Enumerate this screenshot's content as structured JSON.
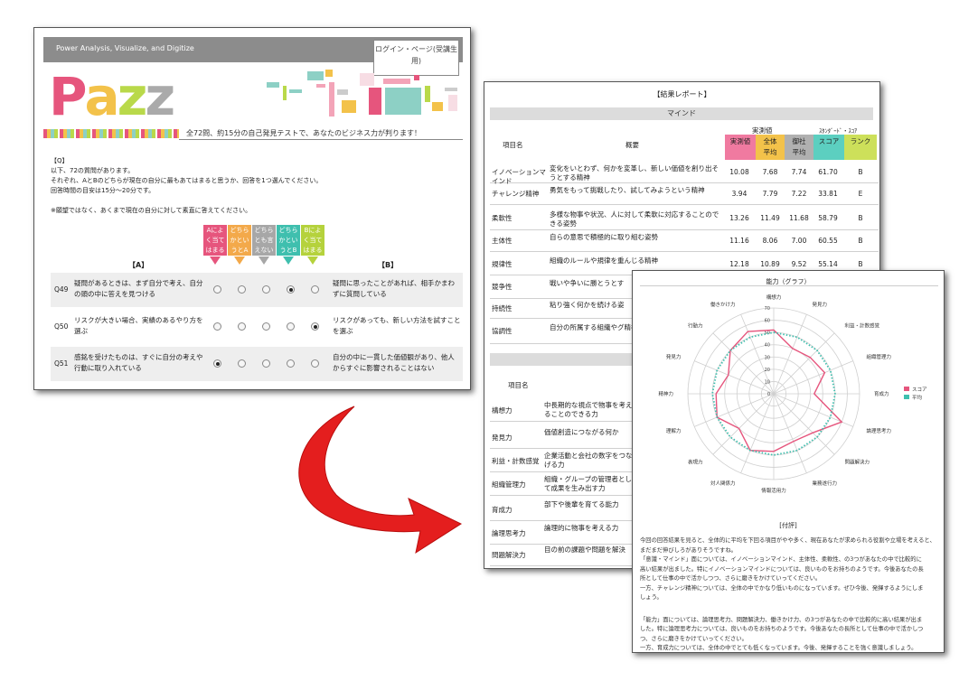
{
  "test_page": {
    "tagline": "Power Analysis, Visualize, and Digitize",
    "login_label": "ログイン・ページ(受講生用)",
    "logo": "Pazz",
    "banner": "全72問、約15分の自己発見テストで、あなたのビジネス力が判ります！",
    "instructions": [
      "【Q】",
      "以下、72の質問があります。",
      "それぞれ、AとBのどちらが現在の自分に最もあてはまると思うか、回答を1つ選んでください。",
      "回答時間の目安は15分～20分です。",
      "",
      "※願望ではなく、あくまで現在の自分に対して素直に答えてください。"
    ],
    "choices": [
      {
        "label": "Aによく当てはまる",
        "color": "#e6557d"
      },
      {
        "label": "どちらかといえばA",
        "color": "#f3a94a"
      },
      {
        "label": "どちらとも言えない",
        "color": "#a7a7a7"
      },
      {
        "label": "どちらかといえばB",
        "color": "#3fbfae"
      },
      {
        "label": "Bによく当てはまる",
        "color": "#b5d23c"
      }
    ],
    "choice_lines": [
      [
        "Aによ",
        "く当て",
        "はまる"
      ],
      [
        "どちら",
        "かとい",
        "うとA"
      ],
      [
        "どちら",
        "とも言",
        "えない"
      ],
      [
        "どちら",
        "かとい",
        "うとB"
      ],
      [
        "Bによ",
        "く当て",
        "はまる"
      ]
    ],
    "label_a": "【A】",
    "label_b": "【B】",
    "questions": [
      {
        "num": "Q49",
        "a": "疑問があるときは、まず自分で考え、自分の頭の中に答えを見つける",
        "b": "疑問に思ったことがあれば、相手かまわずに質問している",
        "selected": 3
      },
      {
        "num": "Q50",
        "a": "リスクが大きい場合、実績のあるやり方を選ぶ",
        "b": "リスクがあっても、新しい方法を試すことを選ぶ",
        "selected": 4
      },
      {
        "num": "Q51",
        "a": "感銘を受けたものは、すぐに自分の考えや行動に取り入れている",
        "b": "自分の中に一貫した価値観があり、他人からすぐに影響されることはない",
        "selected": 0
      }
    ]
  },
  "report": {
    "title": "【結果レポート】",
    "section1": "マインド",
    "col_item": "項目名",
    "col_summary": "概要",
    "col_actual_group": "実測値",
    "col_standard_group": "ｽﾀﾝﾀﾞｰﾄﾞ・ｽｺｱ",
    "col_heads": [
      "実測値",
      "全体平均",
      "御社平均",
      "スコア",
      "ランク"
    ],
    "col_colors": [
      "#f07aa0",
      "#f3c24a",
      "#b0b0b0",
      "#5ccfc0",
      "#cde05a"
    ],
    "mind_rows": [
      {
        "name": "イノベーションマインド",
        "desc": "変化をいとわず、何かを変革し、新しい価値を創り出そうとする精神",
        "v": [
          "10.08",
          "7.68",
          "7.74",
          "61.70",
          "B"
        ]
      },
      {
        "name": "チャレンジ精神",
        "desc": "勇気をもって挑戦したり、試してみようという精神",
        "v": [
          "3.94",
          "7.79",
          "7.22",
          "33.81",
          "E"
        ]
      },
      {
        "name": "柔軟性",
        "desc": "多様な物事や状況、人に対して柔軟に対応することのできる姿勢",
        "v": [
          "13.26",
          "11.49",
          "11.68",
          "58.79",
          "B"
        ]
      },
      {
        "name": "主体性",
        "desc": "自らの意思で積極的に取り組む姿勢",
        "v": [
          "11.16",
          "8.06",
          "7.00",
          "60.55",
          "B"
        ]
      },
      {
        "name": "規律性",
        "desc": "組織のルールや規律を重んじる精神",
        "v": [
          "12.18",
          "10.89",
          "9.52",
          "55.14",
          "B"
        ]
      },
      {
        "name": "競争性",
        "desc": "戦いや争いに勝とうとす",
        "v": [
          "",
          "",
          "",
          "",
          ""
        ]
      },
      {
        "name": "持続性",
        "desc": "粘り強く何かを続ける姿",
        "v": [
          "",
          "",
          "",
          "",
          ""
        ]
      },
      {
        "name": "協調性",
        "desc": "自分の所属する組織やグ精神",
        "v": [
          "",
          "",
          "",
          "",
          ""
        ]
      }
    ],
    "ability_rows": [
      {
        "name": "構想力",
        "desc": "中長期的な視点で物事を考えることのできる力"
      },
      {
        "name": "発見力",
        "desc": "価値創造につながる何か"
      },
      {
        "name": "利益・計数感覚",
        "desc": "企業活動と会社の数字をつなげる力"
      },
      {
        "name": "組織管理力",
        "desc": "組織・グループの管理者として成果を生み出す力"
      },
      {
        "name": "育成力",
        "desc": "部下や後輩を育てる能力"
      },
      {
        "name": "論理思考力",
        "desc": "論理的に物事を考える力"
      },
      {
        "name": "問題解決力",
        "desc": "目の前の課題や問題を解決"
      }
    ]
  },
  "radar": {
    "title": "能力（グラフ）",
    "legend": [
      {
        "name": "スコア",
        "color": "#e6557d"
      },
      {
        "name": "平均",
        "color": "#3fbfae"
      }
    ],
    "comment_title": "[付評]",
    "comments": [
      [
        "今回の回答結果を見ると、全体的に平均を下回る項目がやや多く、現在あなたが求められる役割や立場を考えると、",
        "まだまだ伸びしろがありそうですね。",
        "「意識・マインド」面については、イノベーションマインド、主体性、柔軟性、の3つがあなたの中で比較的に",
        "高い結果が出ました。特にイノベーションマインドについては、良いものをお持ちのようです。今後あなたの長",
        "所として仕事の中で活かしつつ、さらに磨きをかけていってください。",
        "一方、チャレンジ精神については、全体の中でかなり低いものになっています。ぜひ今後、発揮するようにしま",
        "しょう。"
      ],
      [
        "「能力」面については、論理思考力、問題解決力、働きかけ力、の3つがあなたの中で比較的に高い結果が出ま",
        "した。特に論理思考力については、良いものをお持ちのようです。今後あなたの長所として仕事の中で活かしつ",
        "つ、さらに磨きをかけていってください。",
        "一方、育成力については、全体の中でとても低くなっています。今後、発揮することを強く意識しましょう。"
      ]
    ]
  },
  "chart_data": {
    "type": "radar",
    "title": "能力（グラフ）",
    "axes": [
      "構想力",
      "発見力",
      "利益・計数感覚",
      "組織管理力",
      "育成力",
      "論理思考力",
      "問題解決力",
      "業務遂行力",
      "情報活用力",
      "対人関係力",
      "表現力",
      "理解力",
      "精神力",
      "発見力",
      "行動力",
      "働きかけ力"
    ],
    "ticks": [
      "0",
      "10",
      "20",
      "30",
      "40",
      "50",
      "60",
      "70"
    ],
    "range": [
      0,
      70
    ],
    "series": [
      {
        "name": "スコア",
        "color": "#e6557d",
        "values": [
          52,
          40,
          42,
          45,
          33,
          60,
          45,
          42,
          47,
          50,
          40,
          50,
          47,
          40,
          50,
          55
        ]
      },
      {
        "name": "平均",
        "color": "#3fbfae",
        "values": [
          50,
          50,
          50,
          50,
          50,
          50,
          50,
          50,
          50,
          50,
          50,
          50,
          50,
          50,
          50,
          50
        ]
      }
    ]
  }
}
